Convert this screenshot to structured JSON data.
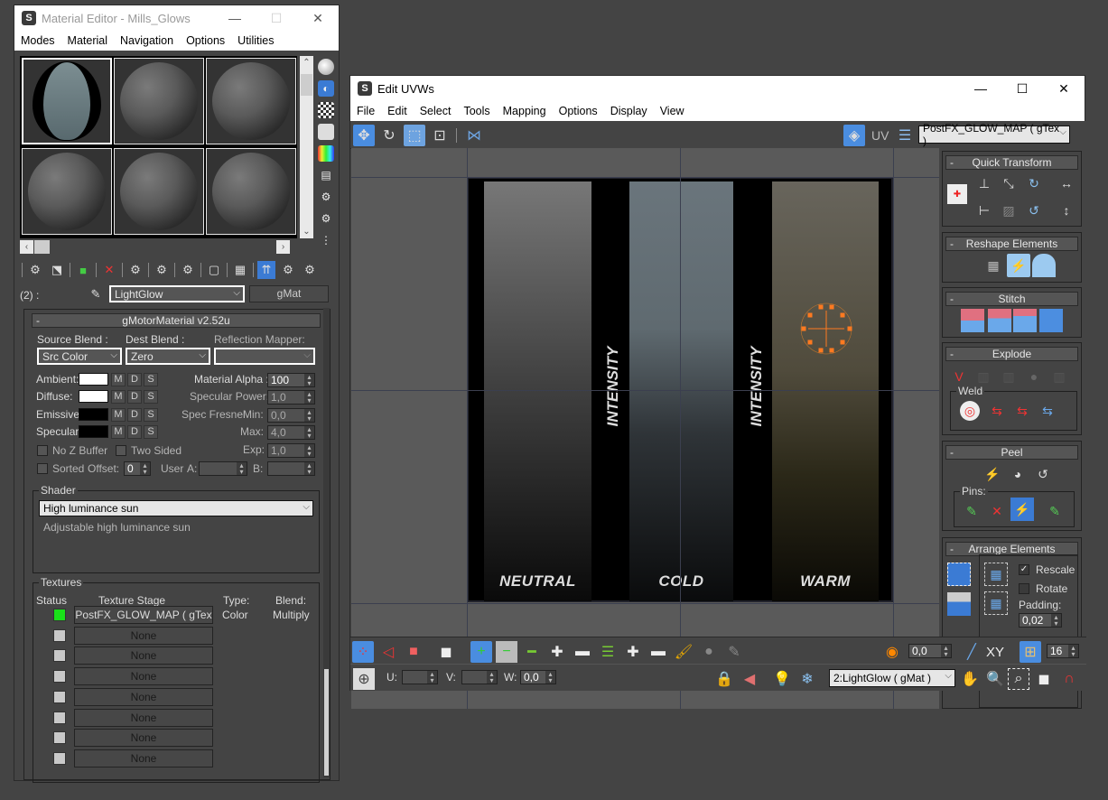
{
  "material_editor": {
    "title": "Material Editor - Mills_Glows",
    "menu": [
      "Modes",
      "Material",
      "Navigation",
      "Options",
      "Utilities"
    ],
    "slot_count_label": "(2) :",
    "material_name": "LightGlow",
    "material_type": "gMat",
    "rollout_title": "gMotorMaterial v2.52u",
    "source_blend_label": "Source Blend :",
    "source_blend_value": "Src Color",
    "dest_blend_label": "Dest Blend :",
    "dest_blend_value": "Zero",
    "reflection_mapper_label": "Reflection Mapper:",
    "reflection_mapper_value": "",
    "colors": [
      {
        "label": "Ambient:",
        "color": "#ffffff"
      },
      {
        "label": "Diffuse:",
        "color": "#ffffff"
      },
      {
        "label": "Emissive:",
        "color": "#000000"
      },
      {
        "label": "Specular:",
        "color": "#000000"
      }
    ],
    "msd": [
      "M",
      "D",
      "S"
    ],
    "material_alpha_label": "Material Alpha :",
    "material_alpha": "100",
    "specular_power_label": "Specular Power:",
    "specular_power": "1,0",
    "spec_fresnel_label": "Spec Fresnel",
    "min_label": "Min:",
    "min_value": "0,0",
    "max_label": "Max:",
    "max_value": "4,0",
    "exp_label": "Exp:",
    "exp_value": "1,0",
    "no_z_buffer": "No Z Buffer",
    "two_sided": "Two Sided",
    "sorted": "Sorted",
    "offset_label": "Offset:",
    "offset_value": "0",
    "user_label": "User",
    "a_label": "A:",
    "b_label": "B:",
    "shader_group": "Shader",
    "shader_value": "High luminance sun",
    "shader_desc": "Adjustable high luminance sun",
    "textures_group": "Textures",
    "tex_headers": {
      "status": "Status",
      "stage": "Texture Stage",
      "type": "Type:",
      "blend": "Blend:"
    },
    "textures": [
      {
        "stage": "PostFX_GLOW_MAP  ( gTex )",
        "type": "Color",
        "blend": "Multiply",
        "status": "#19e019"
      },
      {
        "stage": "None"
      },
      {
        "stage": "None"
      },
      {
        "stage": "None"
      },
      {
        "stage": "None"
      },
      {
        "stage": "None"
      },
      {
        "stage": "None"
      },
      {
        "stage": "None"
      }
    ]
  },
  "edit_uvws": {
    "title": "Edit UVWs",
    "menu": [
      "File",
      "Edit",
      "Select",
      "Tools",
      "Mapping",
      "Options",
      "Display",
      "View"
    ],
    "uv_label": "UV",
    "map_dropdown": "PostFX_GLOW_MAP  ( gTex )",
    "texture_labels": [
      "NEUTRAL",
      "COLD",
      "WARM"
    ],
    "vertical_labels": [
      "INTENSITY",
      "INTENSITY"
    ],
    "sections": {
      "quick_transform": "Quick Transform",
      "reshape": "Reshape Elements",
      "stitch": "Stitch",
      "explode": "Explode",
      "weld": "Weld",
      "peel": "Peel",
      "pins": "Pins:",
      "arrange": "Arrange Elements"
    },
    "rescale_label": "Rescale",
    "rescale_checked": true,
    "rotate_label": "Rotate",
    "padding_label": "Padding:",
    "padding_value": "0,02",
    "angle_value": "0,0",
    "xy_label": "XY",
    "grid_value": "16",
    "u_label": "U:",
    "v_label": "V:",
    "w_label": "W:",
    "w_value": "0,0",
    "material_dropdown": "2:LightGlow  ( gMat )"
  }
}
